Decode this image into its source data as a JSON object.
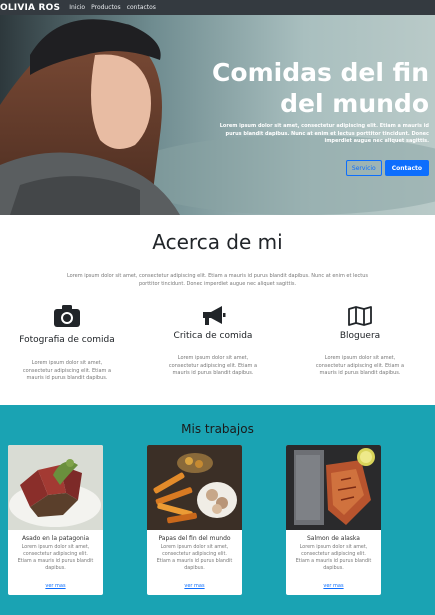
{
  "navbar": {
    "brand": "OLIVIA ROS",
    "links": [
      "Inicio",
      "Productos",
      "contactos"
    ]
  },
  "hero": {
    "title": "Comidas del fin del mundo",
    "text": "Lorem ipsum dolor sit amet, consectetur adipiscing elit. Etiam a mauris id purus blandit dapibus. Nunc at enim et lectus porttitor tincidunt. Donec imperdiet augue nec aliquet sagittis.",
    "button_outline": "Servicio",
    "button_primary": "Contacto"
  },
  "about": {
    "title": "Acerca de mi",
    "text": "Lorem ipsum dolor sit amet, consectetur adipiscing elit. Etiam a mauris id purus blandit dapibus. Nunc at enim et lectus porttitor tincidunt. Donec imperdiet augue nec aliquet sagittis.",
    "features": [
      {
        "icon": "camera-icon",
        "title": "Fotografia de comida",
        "text": "Lorem ipsum dolor sit amet, consectetur adipiscing elit. Etiam a mauris id purus blandit dapibus."
      },
      {
        "icon": "megaphone-icon",
        "title": "Critica de comida",
        "text": "Lorem ipsum dolor sit amet, consectetur adipiscing elit. Etiam a mauris id purus blandit dapibus."
      },
      {
        "icon": "map-icon",
        "title": "Bloguera",
        "text": "Lorem ipsum dolor sit amet, consectetur adipiscing elit. Etiam a mauris id purus blandit dapibus."
      }
    ]
  },
  "works": {
    "title": "Mis trabajos",
    "cards": [
      {
        "title": "Asado en la patagonia",
        "text": "Lorem ipsum dolor sit amet, consectetur adipiscing elit. Etiam a mauris id purus blandit dapibus.",
        "link": "ver mas"
      },
      {
        "title": "Papas del fin del mundo",
        "text": "Lorem ipsum dolor sit amet, consectetur adipiscing elit. Etiam a mauris id purus blandit dapibus.",
        "link": "ver mas"
      },
      {
        "title": "Salmon de alaska",
        "text": "Lorem ipsum dolor sit amet, consectetur adipiscing elit. Etiam a mauris id purus blandit dapibus.",
        "link": "ver mas"
      }
    ]
  },
  "colors": {
    "navbar": "#343a40",
    "primary": "#0d6efd",
    "works_bg": "#1aa3b3"
  }
}
